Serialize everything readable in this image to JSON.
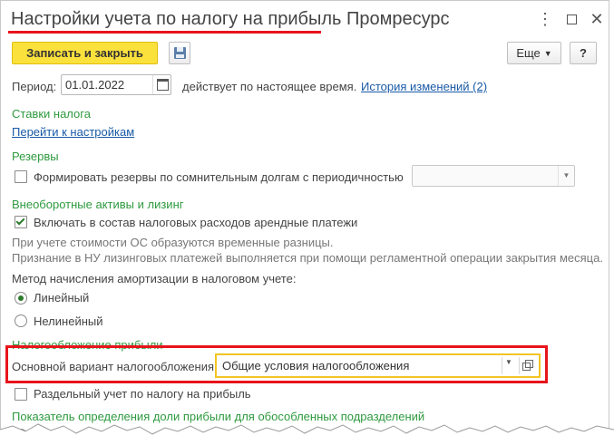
{
  "window": {
    "title": "Настройки учета по налогу на прибыль Промресурс",
    "more_icon": "⋮",
    "close_icon": "✕"
  },
  "toolbar": {
    "save_close_label": "Записать и закрыть",
    "more_label": "Еще",
    "help_label": "?"
  },
  "period": {
    "label": "Период:",
    "value": "01.01.2022",
    "note": "действует по настоящее время.",
    "history_link": "История изменений (2)"
  },
  "tax_rates": {
    "heading": "Ставки налога",
    "settings_link": "Перейти к настройкам"
  },
  "reserves": {
    "heading": "Резервы",
    "checkbox_label": "Формировать резервы по сомнительным долгам с периодичностью",
    "checked": false
  },
  "assets": {
    "heading": "Внеоборотные активы и лизинг",
    "checkbox_label": "Включать в состав налоговых расходов арендные платежи",
    "checked": true,
    "note_line1": "При учете стоимости ОС образуются временные разницы.",
    "note_line2": "Признание в НУ лизинговых платежей выполняется при помощи регламентной операции закрытия месяца."
  },
  "depreciation": {
    "label": "Метод начисления амортизации в налоговом учете:",
    "options": [
      "Линейный",
      "Нелинейный"
    ],
    "selected": "Линейный"
  },
  "taxation": {
    "heading": "Налогообложение прибыли",
    "main_label": "Основной вариант налогообложения:",
    "main_value": "Общие условия налогообложения",
    "separate_label": "Раздельный учет по налогу на прибыль",
    "separate_checked": false
  },
  "share_indicator": {
    "heading": "Показатель определения доли прибыли для обособленных подразделений"
  },
  "colors": {
    "accent_yellow": "#fbe13c",
    "section_green": "#2e9a3f",
    "highlight_red": "#e8141b",
    "link_blue": "#1a5aa6"
  }
}
